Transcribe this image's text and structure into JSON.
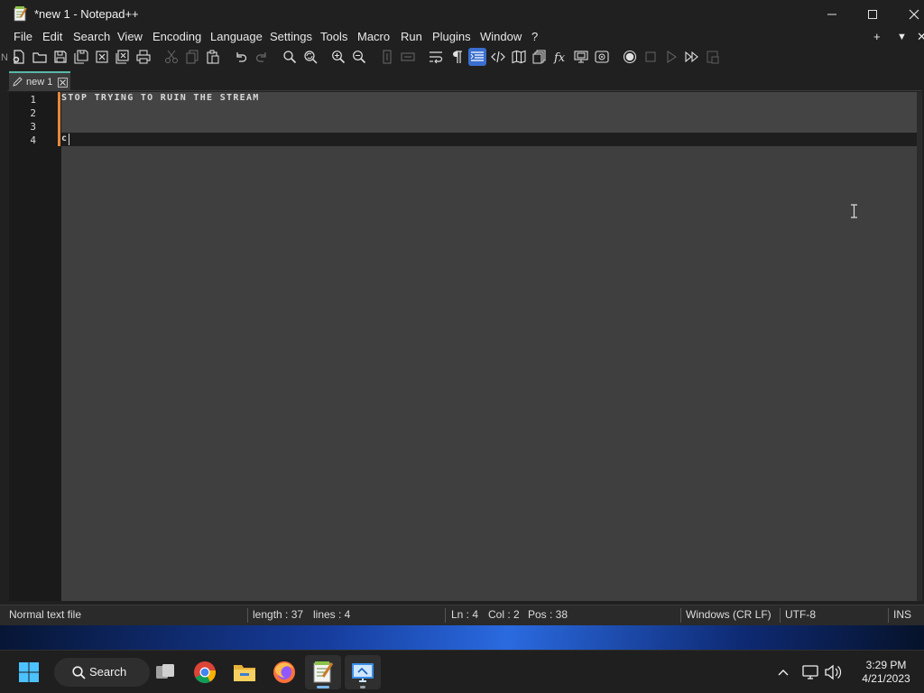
{
  "window": {
    "title": "*new 1 - Notepad++"
  },
  "menu": {
    "items": [
      "File",
      "Edit",
      "Search",
      "View",
      "Encoding",
      "Language",
      "Settings",
      "Tools",
      "Macro",
      "Run",
      "Plugins",
      "Window",
      "?"
    ],
    "right_plus": "+",
    "right_dropdown": "▼",
    "right_close": "✕"
  },
  "toolbar": {
    "active_button": "word-wrap-indent-guide",
    "edge_letter": "N"
  },
  "tabs": [
    {
      "label": "new 1",
      "icon": "pencil-icon",
      "modified": true
    }
  ],
  "editor": {
    "lines": [
      {
        "number": "1",
        "text": "STOP TRYING TO RUIN THE STREAM",
        "changed": true
      },
      {
        "number": "2",
        "text": "",
        "changed": true
      },
      {
        "number": "3",
        "text": "",
        "changed": true
      },
      {
        "number": "4",
        "text": "c",
        "changed": true,
        "current": true
      }
    ]
  },
  "statusbar": {
    "file_type": "Normal text file",
    "length": "length : 37",
    "lines": "lines : 4",
    "ln": "Ln : 4",
    "col": "Col : 2",
    "pos": "Pos : 38",
    "eol": "Windows (CR LF)",
    "encoding": "UTF-8",
    "mode": "INS"
  },
  "taskbar": {
    "search_label": "Search",
    "apps": [
      "windows-start",
      "search",
      "task-view",
      "chrome",
      "file-explorer",
      "firefox",
      "notepad-plus-plus",
      "remote-desktop"
    ],
    "time": "3:29 PM",
    "date": "4/21/2023"
  },
  "colors": {
    "accent": "#3a6fd0",
    "change_marker": "#e8883a",
    "tab_accent": "#58b8a8"
  }
}
